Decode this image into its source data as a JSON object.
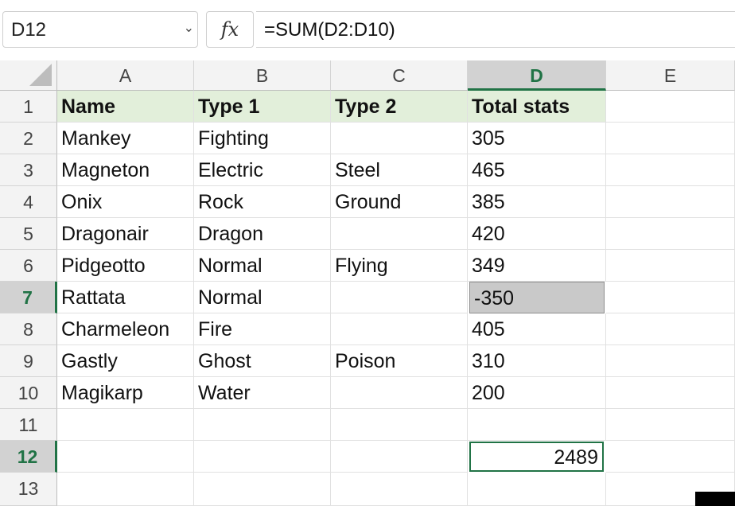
{
  "formula_bar": {
    "name_box": "D12",
    "fx_label": "fx",
    "formula": "=SUM(D2:D10)"
  },
  "columns": [
    "A",
    "B",
    "C",
    "D",
    "E"
  ],
  "rows": [
    "1",
    "2",
    "3",
    "4",
    "5",
    "6",
    "7",
    "8",
    "9",
    "10",
    "11",
    "12",
    "13"
  ],
  "sheet": {
    "r1": [
      "Name",
      "Type 1",
      "Type 2",
      "Total stats"
    ],
    "r2": [
      "Mankey",
      "Fighting",
      "",
      "305"
    ],
    "r3": [
      "Magneton",
      "Electric",
      "Steel",
      "465"
    ],
    "r4": [
      "Onix",
      "Rock",
      "Ground",
      "385"
    ],
    "r5": [
      "Dragonair",
      "Dragon",
      "",
      "420"
    ],
    "r6": [
      "Pidgeotto",
      "Normal",
      "Flying",
      "349"
    ],
    "r7": [
      "Rattata",
      "Normal",
      "",
      "-350"
    ],
    "r8": [
      "Charmeleon",
      "Fire",
      "",
      "405"
    ],
    "r9": [
      "Gastly",
      "Ghost",
      "Poison",
      "310"
    ],
    "r10": [
      "Magikarp",
      "Water",
      "",
      "200"
    ],
    "r12": [
      "",
      "",
      "",
      "2489"
    ]
  },
  "colors": {
    "accent": "#217346",
    "header_fill": "#e2efda",
    "highlight_fill": "#c9c9c9"
  }
}
